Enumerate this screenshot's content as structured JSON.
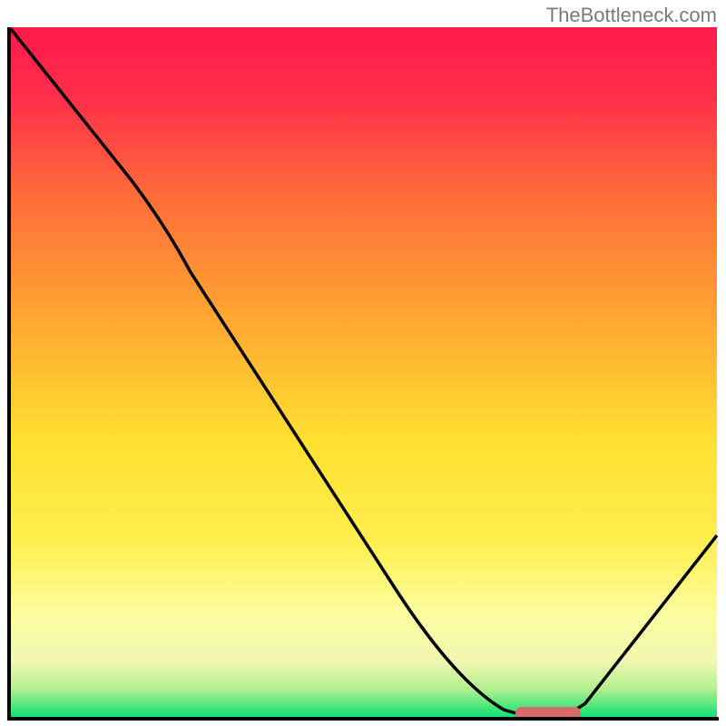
{
  "watermark": "TheBottleneck.com",
  "chart_data": {
    "type": "line",
    "title": "",
    "xlabel": "",
    "ylabel": "",
    "xlim": [
      0,
      100
    ],
    "ylim": [
      0,
      100
    ],
    "curve": [
      {
        "x": 1,
        "y": 99
      },
      {
        "x": 15,
        "y": 80
      },
      {
        "x": 21,
        "y": 72
      },
      {
        "x": 28,
        "y": 63
      },
      {
        "x": 40,
        "y": 44
      },
      {
        "x": 55,
        "y": 22
      },
      {
        "x": 65,
        "y": 7
      },
      {
        "x": 70,
        "y": 1
      },
      {
        "x": 75,
        "y": 0.5
      },
      {
        "x": 80,
        "y": 1
      },
      {
        "x": 88,
        "y": 11
      },
      {
        "x": 99,
        "y": 25
      }
    ],
    "optimal_zone": {
      "x_start": 71.5,
      "x_end": 80.5,
      "y": 0.8
    },
    "gradient_colors": {
      "top": "#ff1744",
      "upper_mid": "#ff9100",
      "mid": "#ffeb3b",
      "lower_mid": "#fff59d",
      "bottom": "#00e676"
    },
    "border_color": "#000000",
    "curve_color": "#000000",
    "optimal_marker_color": "#d96a6a"
  }
}
